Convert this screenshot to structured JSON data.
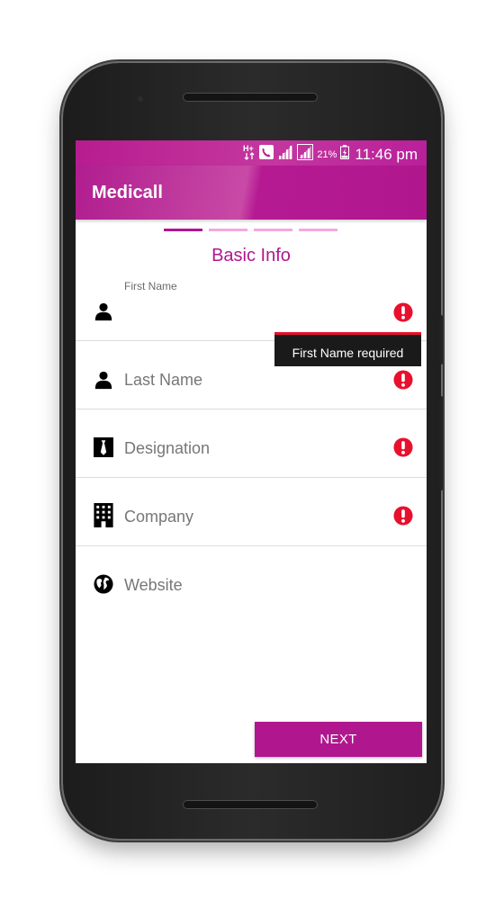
{
  "status_bar": {
    "battery_percent": "21%",
    "time": "11:46 pm",
    "icons": [
      "network-type-icon",
      "call-icon",
      "signal-icon",
      "signal-icon",
      "battery-icon"
    ]
  },
  "app_bar": {
    "title": "Medicall"
  },
  "stepper": {
    "total_steps": 4,
    "current_step": 1
  },
  "section_title": "Basic Info",
  "fields": {
    "first_name": {
      "label": "First Name",
      "value": "",
      "icon": "person-icon",
      "error_icon": "error-icon"
    },
    "last_name": {
      "placeholder": "Last Name",
      "icon": "person-icon",
      "error_icon": "error-icon"
    },
    "designation": {
      "placeholder": "Designation",
      "icon": "tie-icon",
      "error_icon": "error-icon"
    },
    "company": {
      "placeholder": "Company",
      "icon": "building-icon",
      "error_icon": "error-icon"
    },
    "website": {
      "placeholder": "Website",
      "icon": "globe-icon"
    }
  },
  "error_tooltip": {
    "text": "First Name required"
  },
  "next_button": {
    "label": "NEXT"
  },
  "colors": {
    "primary": "#b0178e",
    "step_inactive": "#f4a8de",
    "error": "#e8112d",
    "tooltip_bg": "#1a1a1a"
  }
}
